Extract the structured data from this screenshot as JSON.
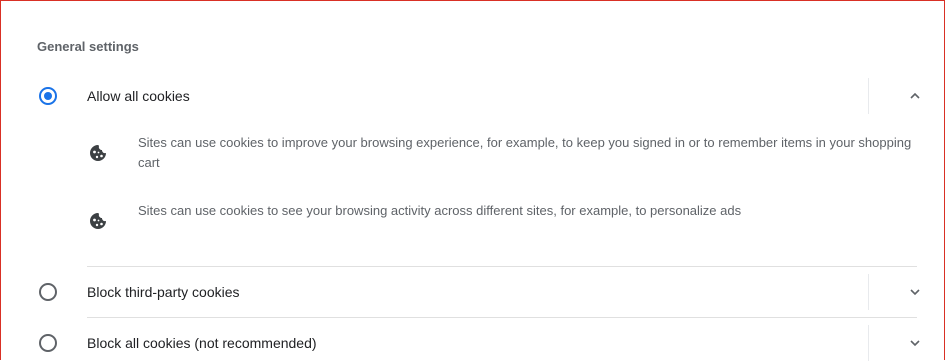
{
  "section": {
    "title": "General settings"
  },
  "options": [
    {
      "label": "Allow all cookies",
      "selected": true,
      "expanded": true,
      "descriptions": [
        {
          "icon": "cookie-icon",
          "text": "Sites can use cookies to improve your browsing experience, for example, to keep you signed in or to remember items in your shopping cart"
        },
        {
          "icon": "cookie-icon",
          "text": "Sites can use cookies to see your browsing activity across different sites, for example, to personalize ads"
        }
      ]
    },
    {
      "label": "Block third-party cookies",
      "selected": false,
      "expanded": false
    },
    {
      "label": "Block all cookies (not recommended)",
      "selected": false,
      "expanded": false
    }
  ],
  "colors": {
    "accent": "#1a73e8",
    "frame_border": "#d93025",
    "text": "#202124",
    "secondary_text": "#5f6368"
  }
}
